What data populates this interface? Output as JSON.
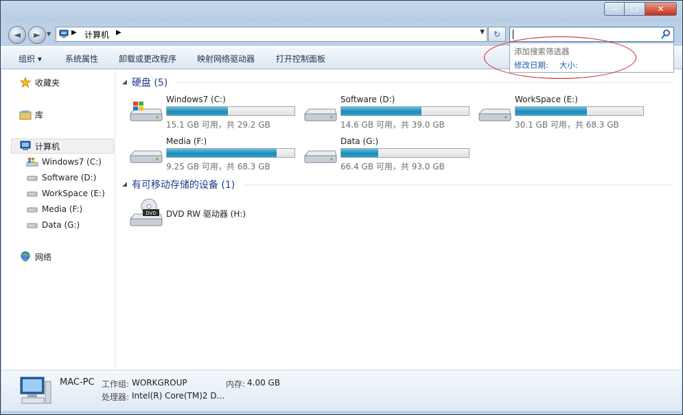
{
  "window": {
    "caption": {
      "minimize": "—",
      "maximize": "☐",
      "close": "✕"
    }
  },
  "nav": {
    "back": "◄",
    "forward": "►",
    "recent": "▼",
    "address": {
      "sep1": "▶",
      "location": "计算机",
      "sep2": "▶",
      "dropdown": "▼"
    },
    "refresh": "↻"
  },
  "toolbar": {
    "organize": "组织 ▾",
    "system_properties": "系统属性",
    "uninstall": "卸载或更改程序",
    "map_drive": "映射网络驱动器",
    "control_panel": "打开控制面板"
  },
  "search_suggest": {
    "title": "添加搜索筛选器",
    "filter_date": "修改日期:",
    "filter_size": "大小:"
  },
  "sidebar": {
    "favorites": "收藏夹",
    "libraries": "库",
    "computer": "计算机",
    "drives": [
      "Windows7 (C:)",
      "Software (D:)",
      "WorkSpace (E:)",
      "Media (F:)",
      "Data (G:)"
    ],
    "network": "网络"
  },
  "groups": {
    "hard_disks": "硬盘 (5)",
    "removable": "有可移动存储的设备 (1)"
  },
  "drives": [
    {
      "name": "Windows7 (C:)",
      "info": "15.1 GB 可用，共 29.2 GB",
      "used_fraction": 0.48
    },
    {
      "name": "Software (D:)",
      "info": "14.6 GB 可用，共 39.0 GB",
      "used_fraction": 0.63
    },
    {
      "name": "WorkSpace (E:)",
      "info": "30.1 GB 可用，共 68.3 GB",
      "used_fraction": 0.56
    },
    {
      "name": "Media (F:)",
      "info": "9.25 GB 可用，共 68.3 GB",
      "used_fraction": 0.86
    },
    {
      "name": "Data (G:)",
      "info": "66.4 GB 可用，共 93.0 GB",
      "used_fraction": 0.29
    }
  ],
  "removable_drive": {
    "name": "DVD RW 驱动器 (H:)",
    "icon_label": "DVD"
  },
  "status": {
    "pc_name": "MAC-PC",
    "workgroup_label": "工作组:",
    "workgroup": "WORKGROUP",
    "memory_label": "内存:",
    "memory": "4.00 GB",
    "cpu_label": "处理器:",
    "cpu": "Intel(R) Core(TM)2 D..."
  }
}
